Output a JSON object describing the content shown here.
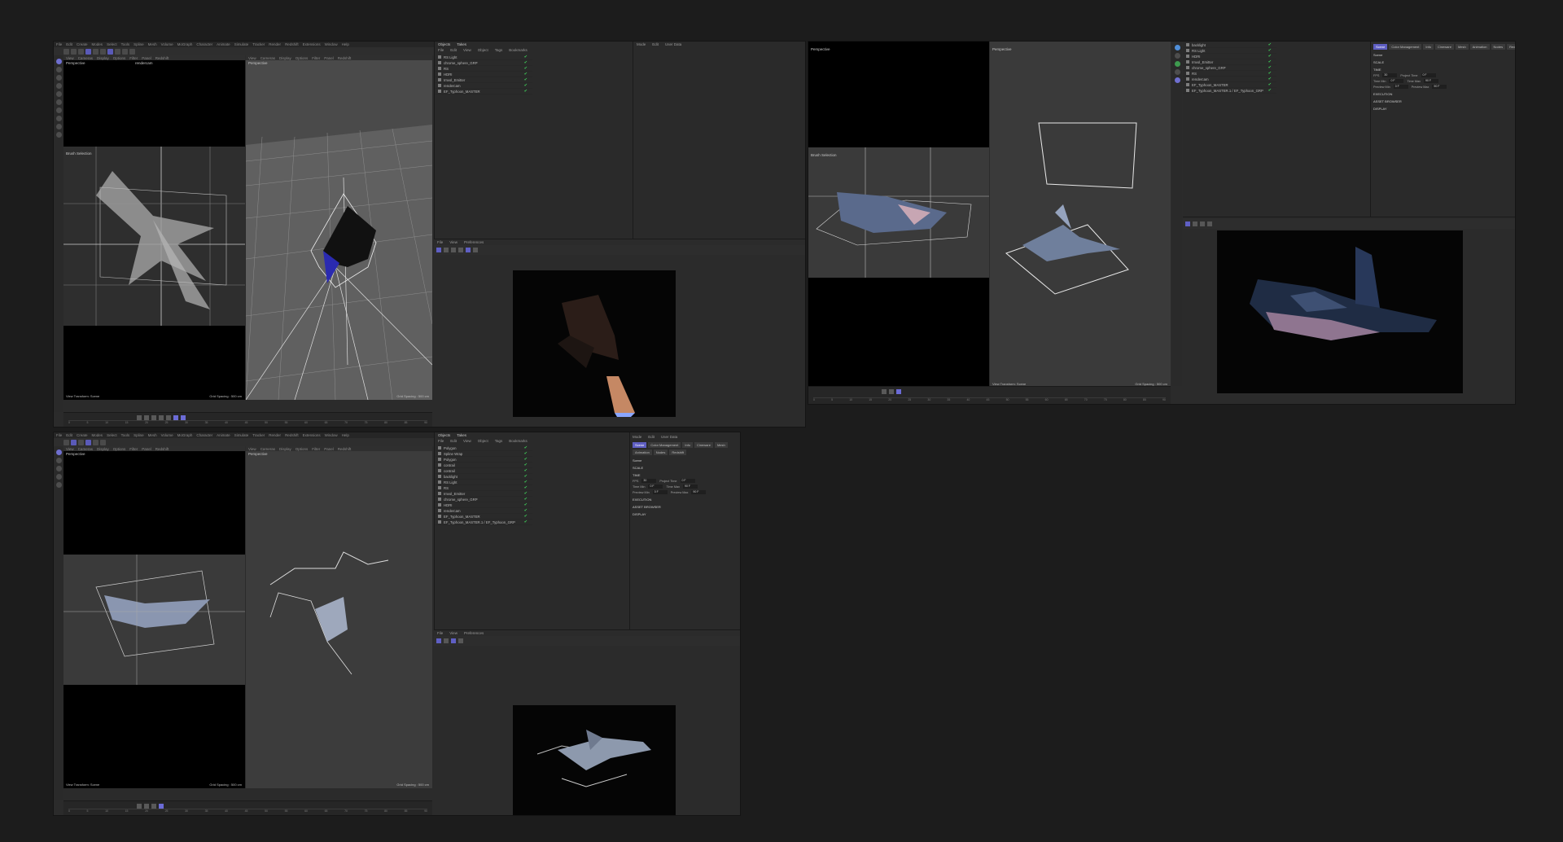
{
  "menus": {
    "main": [
      "File",
      "Edit",
      "Create",
      "Modes",
      "Select",
      "Tools",
      "Spline",
      "Mesh",
      "Volume",
      "MoGraph",
      "Character",
      "Animate",
      "Simulate",
      "Tracker",
      "Render",
      "Redshift",
      "Extensions",
      "Window",
      "Help"
    ],
    "viewport_left": [
      "View",
      "Cameras",
      "Display",
      "Options",
      "Filter",
      "Panel",
      "Redshift"
    ],
    "viewport_right": [
      "View",
      "Cameras",
      "Display",
      "Options",
      "Filter",
      "Panel",
      "Redshift"
    ],
    "objects_tabs": [
      "Objects",
      "Takes"
    ],
    "objects_menu": [
      "File",
      "Edit",
      "View",
      "Object",
      "Tags",
      "Bookmarks"
    ],
    "attr_menu": [
      "Mode",
      "Edit",
      "User Data"
    ],
    "render_menu": [
      "File",
      "View",
      "Preferences"
    ]
  },
  "viewports": {
    "left_label": "Perspective",
    "right_label": "Perspective",
    "camera": "rendercam",
    "footer_left": "View Transform: Scene",
    "footer_right": "Grid Spacing : 500 cm",
    "brush": "Brush Selection"
  },
  "objects_top": [
    "RS Light",
    "chrome_sphere_GRP",
    "RS",
    "HDRI",
    "Imvol_Emitter",
    "rendercam",
    "EF_Typhoon_MASTER"
  ],
  "objects_bottom": [
    "Polygon",
    "Spline Wrap",
    "Polygon",
    "contrail",
    "contrail",
    "backlight",
    "RS Light",
    "RS",
    "Imvol_Emitter",
    "chrome_sphere_GRP",
    "HDRI",
    "rendercam",
    "EF_Typhoon_MASTER",
    "EF_Typhoon_MASTER.1 / EF_Typhoon_GRP"
  ],
  "objects_right": [
    "backlight",
    "RS Light",
    "HDRI",
    "Imvol_Emitter",
    "chrome_sphere_GRP",
    "RS",
    "rendercam",
    "EF_Typhoon_MASTER",
    "EF_Typhoon_MASTER.1 / EF_Typhoon_GRP"
  ],
  "attributes": {
    "tabs": [
      "Scene",
      "Color Management",
      "Info",
      "Cineware",
      "Mesh",
      "Animation",
      "Nodes",
      "Redshift"
    ],
    "section": "Scene",
    "groups": [
      "SCALE",
      "TIME",
      "EXECUTION",
      "ASSET BROWSER",
      "DISPLAY"
    ],
    "fields": [
      {
        "label": "FPS",
        "value": "30",
        "label2": "Project Time",
        "value2": "0 F"
      },
      {
        "label": "Time Min",
        "value": "0 F",
        "label2": "Time Max",
        "value2": "90 F"
      },
      {
        "label": "Preview Min",
        "value": "0 F",
        "label2": "Preview Max",
        "value2": "90 F"
      }
    ]
  },
  "timeline": {
    "frame": "0 F",
    "ticks": [
      "0",
      "5",
      "10",
      "15",
      "20",
      "25",
      "30",
      "35",
      "40",
      "45",
      "50",
      "55",
      "60",
      "65",
      "70",
      "75",
      "80",
      "85",
      "90"
    ]
  },
  "colors": {
    "accent": "#5e5ec2",
    "check": "#3fd15a",
    "bg": "#1c1c1c",
    "panel": "#2b2b2b"
  }
}
